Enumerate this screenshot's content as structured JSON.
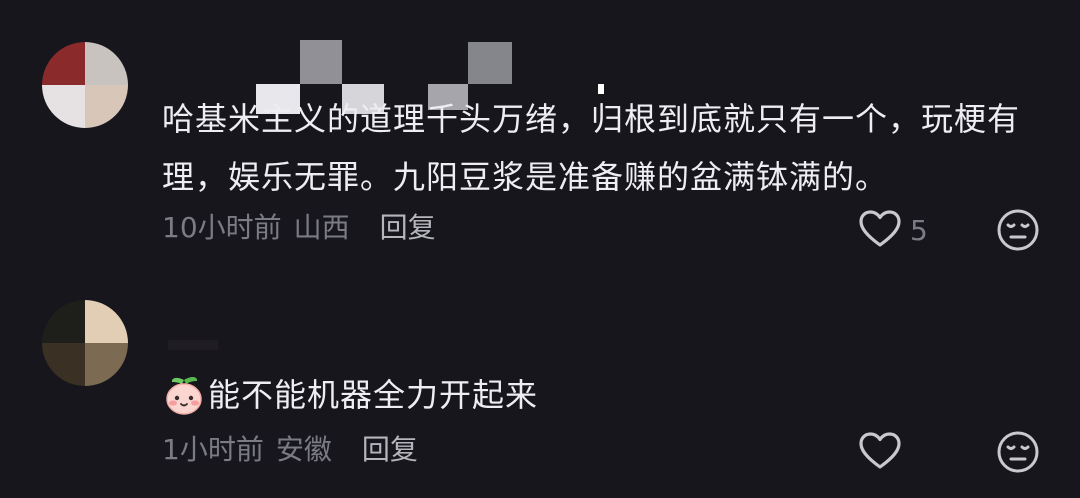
{
  "comments": [
    {
      "text": "哈基米主义的道理千头万绪，归根到底就只有一个，玩梗有理，娱乐无罪。九阳豆浆是准备赚的盆满钵满的。",
      "time": "10小时前",
      "location": "山西",
      "reply_label": "回复",
      "like_count": "5",
      "avatar_colors": [
        "#8a2a2a",
        "#c9c3bf",
        "#e6e2e3",
        "#d8c6b8"
      ]
    },
    {
      "sticker_icon": "peach-face-sticker-icon",
      "text": "能不能机器全力开起来",
      "time": "1小时前",
      "location": "安徽",
      "reply_label": "回复",
      "like_count": "",
      "avatar_colors": [
        "#1e1e1b",
        "#e2cdb5",
        "#3a3024",
        "#7d6a52"
      ]
    }
  ],
  "colors": {
    "background": "#16161c",
    "text": "#eeeef2",
    "meta": "#7b7b84",
    "icon": "#c8c8ce"
  }
}
